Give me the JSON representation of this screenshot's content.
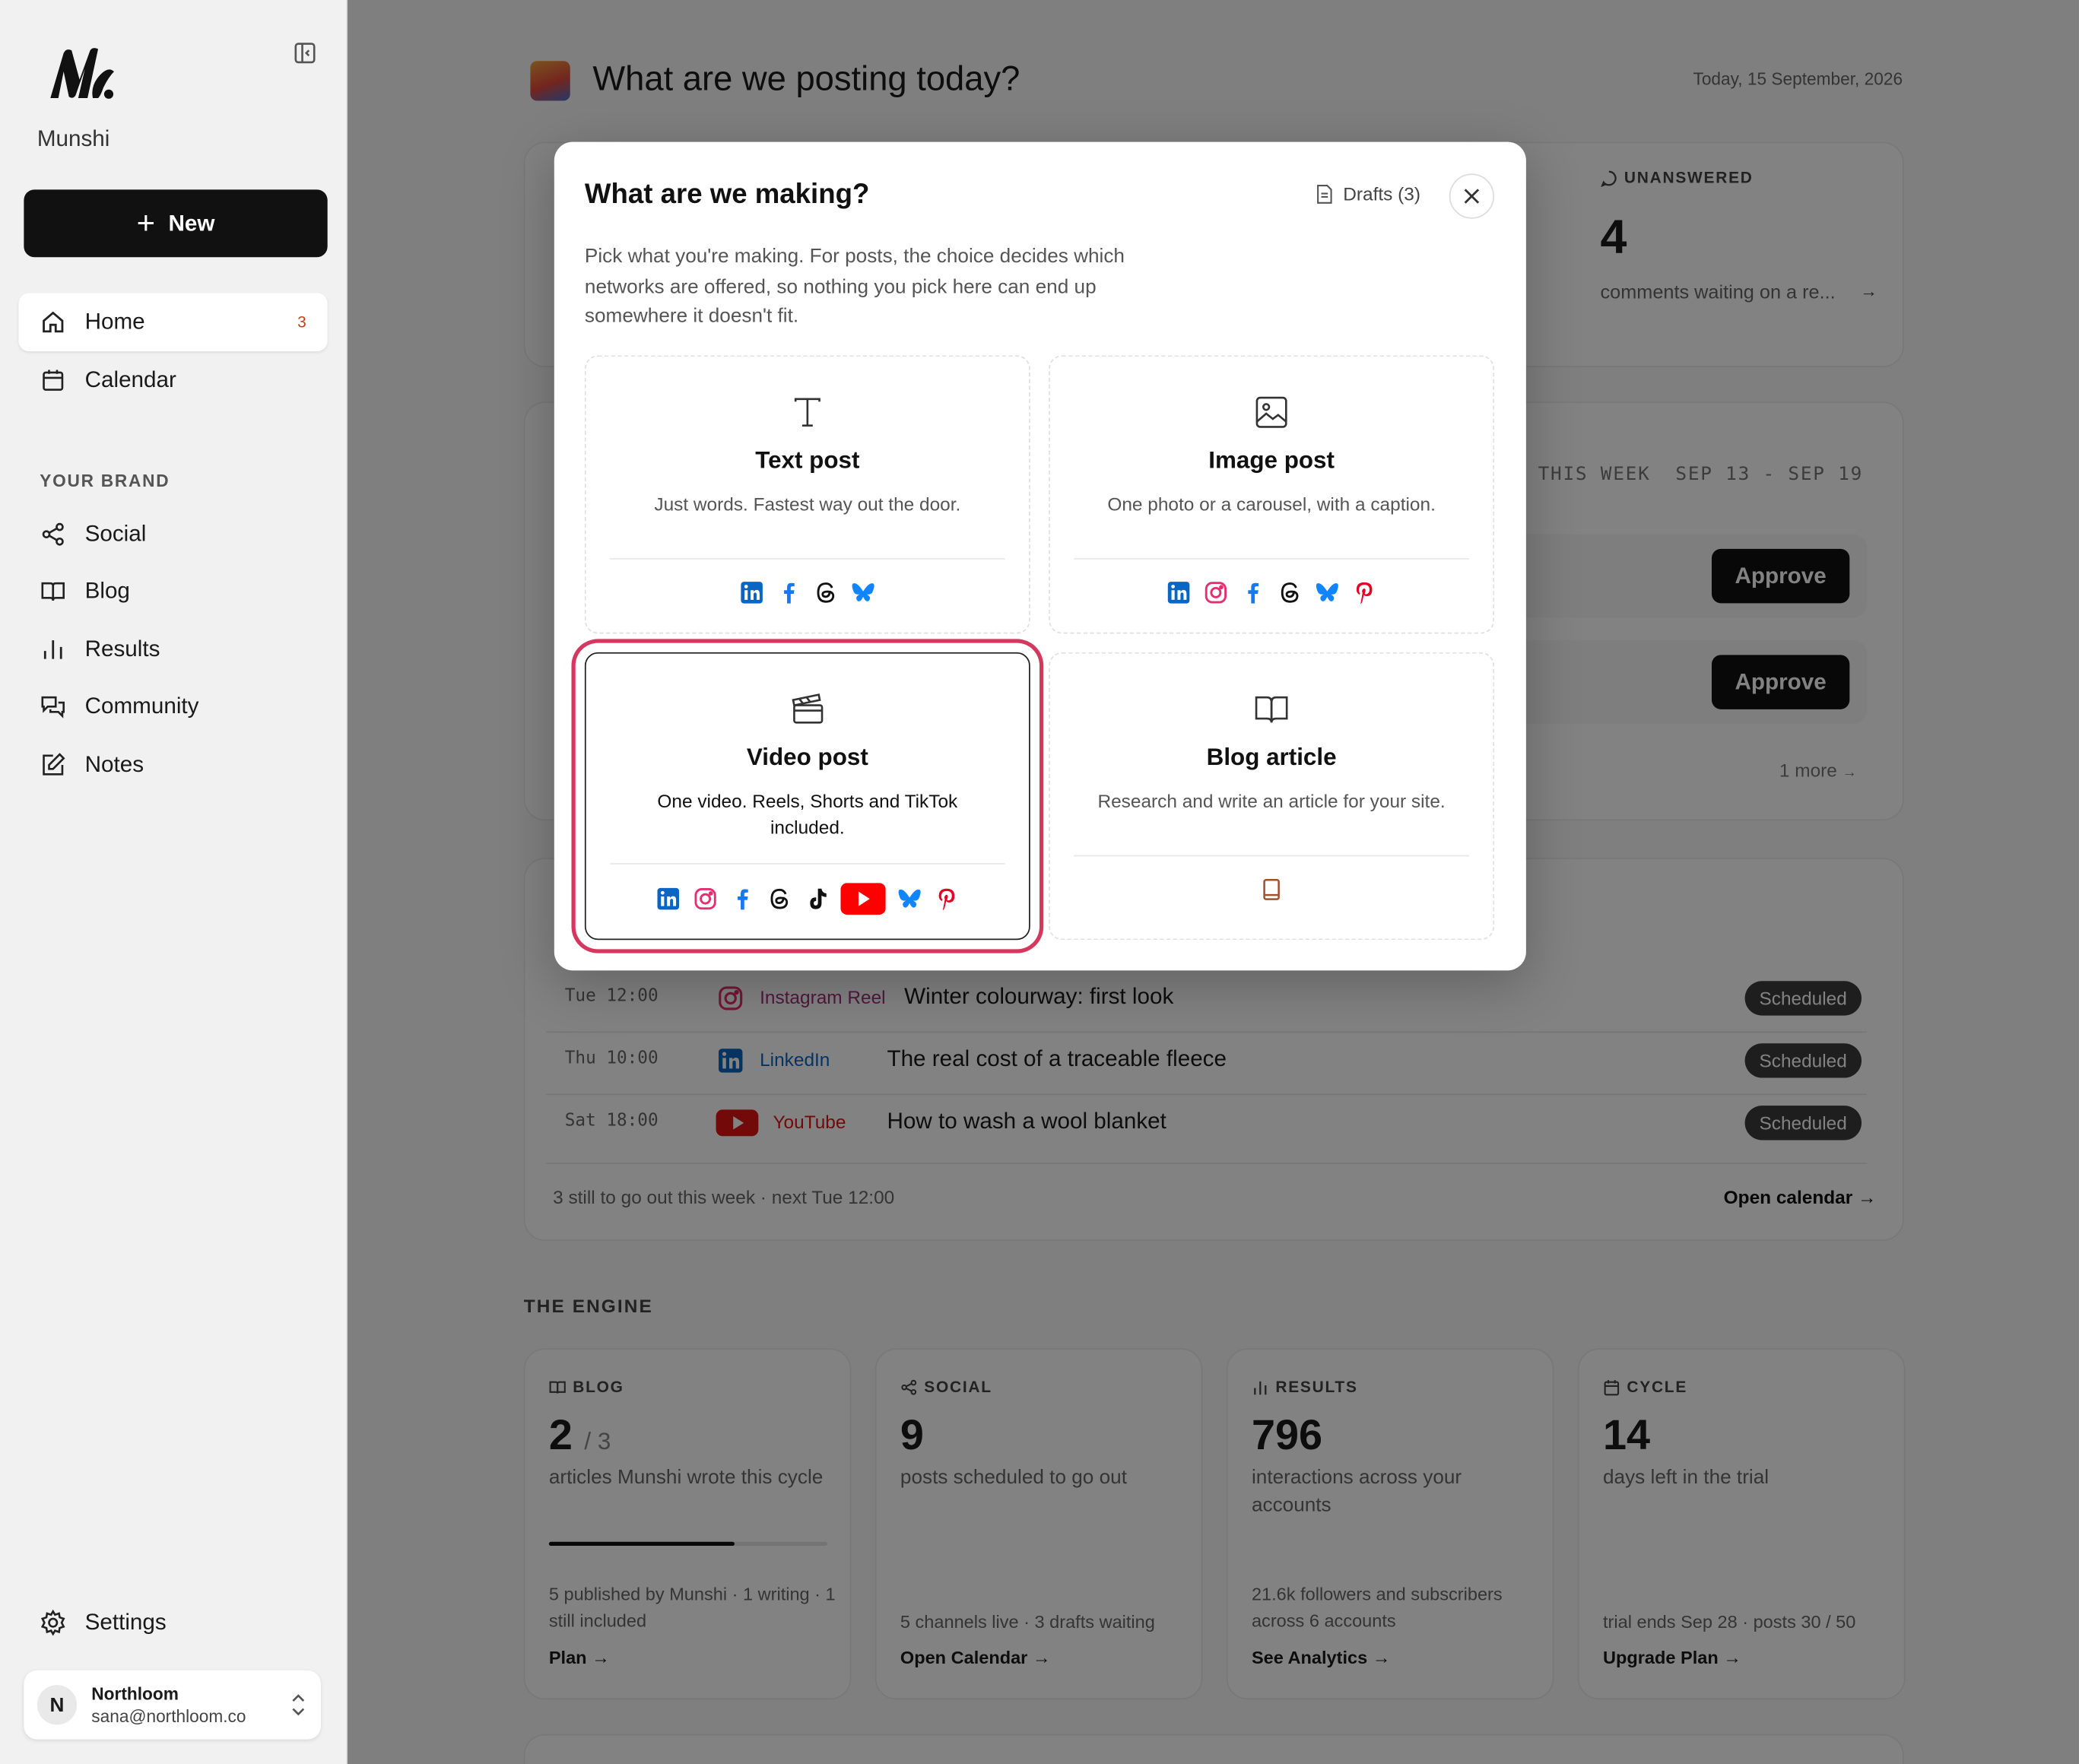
{
  "sidebar": {
    "brand": "Munshi",
    "new_label": "New",
    "nav": [
      {
        "label": "Home",
        "badge": "3"
      },
      {
        "label": "Calendar"
      }
    ],
    "section_label": "YOUR BRAND",
    "brand_nav": [
      {
        "label": "Social"
      },
      {
        "label": "Blog"
      },
      {
        "label": "Results"
      },
      {
        "label": "Community"
      },
      {
        "label": "Notes"
      }
    ],
    "settings_label": "Settings",
    "account": {
      "initial": "N",
      "name": "Northloom",
      "email": "sana@northloom.co"
    }
  },
  "header": {
    "title": "What are we posting today?",
    "date": "Today, 15 September, 2026"
  },
  "unanswered": {
    "label": "UNANSWERED",
    "count": "4",
    "desc": "comments waiting on a re..."
  },
  "this_week": {
    "label": "THIS WEEK",
    "range": "SEP 13 - SEP 19",
    "approve_label": "Approve",
    "more": "1 more"
  },
  "schedule": {
    "rows": [
      {
        "time": "Tue 12:00",
        "network": "Instagram Reel",
        "title": "Winter colourway: first look",
        "status": "Scheduled",
        "color": "#a0307a"
      },
      {
        "time": "Thu 10:00",
        "network": "LinkedIn",
        "title": "The real cost of a traceable fleece",
        "status": "Scheduled",
        "color": "#0a66c2"
      },
      {
        "time": "Sat 18:00",
        "network": "YouTube",
        "title": "How to wash a wool blanket",
        "status": "Scheduled",
        "color": "#e01414"
      }
    ],
    "footer": "3 still to go out this week · next Tue 12:00",
    "open_calendar": "Open calendar →"
  },
  "engine": {
    "label": "THE ENGINE",
    "cards": [
      {
        "label": "BLOG",
        "value": "2",
        "value_of": "/ 3",
        "desc": "articles Munshi wrote this cycle",
        "foot": "5 published by Munshi · 1 writing · 1 still included",
        "link": "Plan →",
        "progress": 0.667
      },
      {
        "label": "SOCIAL",
        "value": "9",
        "desc": "posts scheduled to go out",
        "foot": "5 channels live · 3 drafts waiting",
        "link": "Open Calendar →"
      },
      {
        "label": "RESULTS",
        "value": "796",
        "desc": "interactions across your accounts",
        "foot": "21.6k followers and subscribers across 6 accounts",
        "link": "See Analytics →"
      },
      {
        "label": "CYCLE",
        "value": "14",
        "desc": "days left in the trial",
        "foot": "trial ends Sep 28 · posts 30 / 50",
        "link": "Upgrade Plan →"
      }
    ]
  },
  "modal": {
    "title": "What are we making?",
    "drafts": "Drafts (3)",
    "intro": "Pick what you're making. For posts, the choice decides which networks are offered, so nothing you pick here can end up somewhere it doesn't fit.",
    "options": [
      {
        "title": "Text post",
        "desc": "Just words. Fastest way out the door.",
        "icon": "text-icon",
        "networks": [
          "linkedin",
          "facebook",
          "threads",
          "bluesky"
        ]
      },
      {
        "title": "Image post",
        "desc": "One photo or a carousel, with a caption.",
        "icon": "image-icon",
        "networks": [
          "linkedin",
          "instagram",
          "facebook",
          "threads",
          "bluesky",
          "pinterest"
        ]
      },
      {
        "title": "Video post",
        "desc": "One video. Reels, Shorts and TikTok included.",
        "icon": "clapperboard-icon",
        "selected": true,
        "networks": [
          "linkedin",
          "instagram",
          "facebook",
          "threads",
          "tiktok",
          "youtube",
          "bluesky",
          "pinterest"
        ]
      },
      {
        "title": "Blog article",
        "desc": "Research and write an article for your site.",
        "icon": "book-open-icon",
        "networks": [
          "blog"
        ]
      }
    ]
  },
  "colors": {
    "accent_selected": "#d6375e",
    "linkedin": "#0a66c2",
    "instagram": "#e1306c",
    "facebook": "#1877f2",
    "bluesky": "#1185fe",
    "pinterest": "#e60023",
    "youtube": "#ff0000",
    "blog": "#a0522d"
  }
}
